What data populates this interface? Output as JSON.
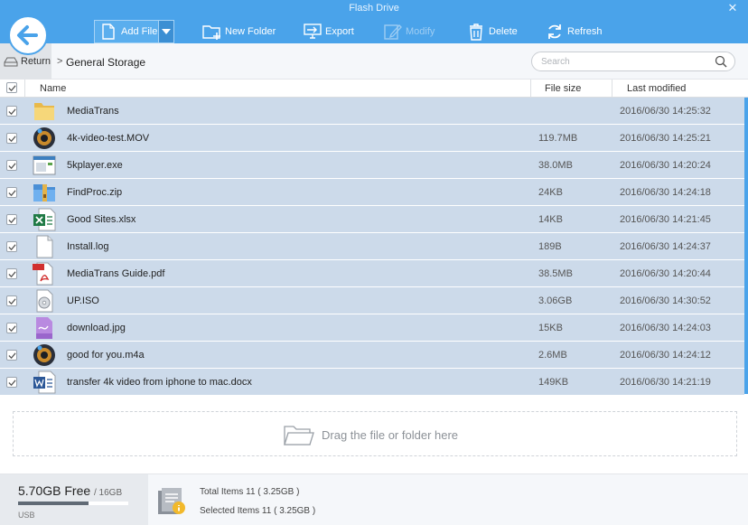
{
  "window": {
    "title": "Flash Drive",
    "close": "✕"
  },
  "toolbar": {
    "add_file": "Add File",
    "new_folder": "New Folder",
    "export": "Export",
    "modify": "Modify",
    "delete": "Delete",
    "refresh": "Refresh"
  },
  "breadcrumb": {
    "return": "Return",
    "separator": ">",
    "current": "General Storage"
  },
  "search": {
    "placeholder": "Search",
    "value": ""
  },
  "table": {
    "columns": {
      "name": "Name",
      "size": "File size",
      "modified": "Last modified"
    },
    "rows": [
      {
        "name": "MediaTrans",
        "size": "",
        "modified": "2016/06/30 14:25:32",
        "icon": "folder-icon",
        "checked": true
      },
      {
        "name": "4k-video-test.MOV",
        "size": "119.7MB",
        "modified": "2016/06/30 14:25:21",
        "icon": "video-file-icon",
        "checked": true
      },
      {
        "name": "5kplayer.exe",
        "size": "38.0MB",
        "modified": "2016/06/30 14:20:24",
        "icon": "exe-file-icon",
        "checked": true
      },
      {
        "name": "FindProc.zip",
        "size": "24KB",
        "modified": "2016/06/30 14:24:18",
        "icon": "zip-file-icon",
        "checked": true
      },
      {
        "name": "Good Sites.xlsx",
        "size": "14KB",
        "modified": "2016/06/30 14:21:45",
        "icon": "excel-file-icon",
        "checked": true
      },
      {
        "name": "Install.log",
        "size": "189B",
        "modified": "2016/06/30 14:24:37",
        "icon": "text-file-icon",
        "checked": true
      },
      {
        "name": "MediaTrans  Guide.pdf",
        "size": "38.5MB",
        "modified": "2016/06/30 14:20:44",
        "icon": "pdf-file-icon",
        "checked": true
      },
      {
        "name": "UP.ISO",
        "size": "3.06GB",
        "modified": "2016/06/30 14:30:52",
        "icon": "iso-file-icon",
        "checked": true
      },
      {
        "name": "download.jpg",
        "size": "15KB",
        "modified": "2016/06/30 14:24:03",
        "icon": "image-file-icon",
        "checked": true
      },
      {
        "name": "good for you.m4a",
        "size": "2.6MB",
        "modified": "2016/06/30 14:24:12",
        "icon": "audio-file-icon",
        "checked": true
      },
      {
        "name": "transfer 4k video from iphone to mac.docx",
        "size": "149KB",
        "modified": "2016/06/30 14:21:19",
        "icon": "word-file-icon",
        "checked": true
      }
    ]
  },
  "dropzone": {
    "text": "Drag the file or folder here"
  },
  "footer": {
    "free": "5.70GB Free",
    "total": "/ 16GB",
    "device": "USB",
    "used_fraction": 0.64,
    "total_items": "Total Items  11  ( 3.25GB )",
    "selected_items": "Selected Items  11  ( 3.25GB )"
  },
  "colors": {
    "accent": "#4aa3ea",
    "row_selected": "#ccdaea",
    "storage_bar": "#606a75"
  }
}
